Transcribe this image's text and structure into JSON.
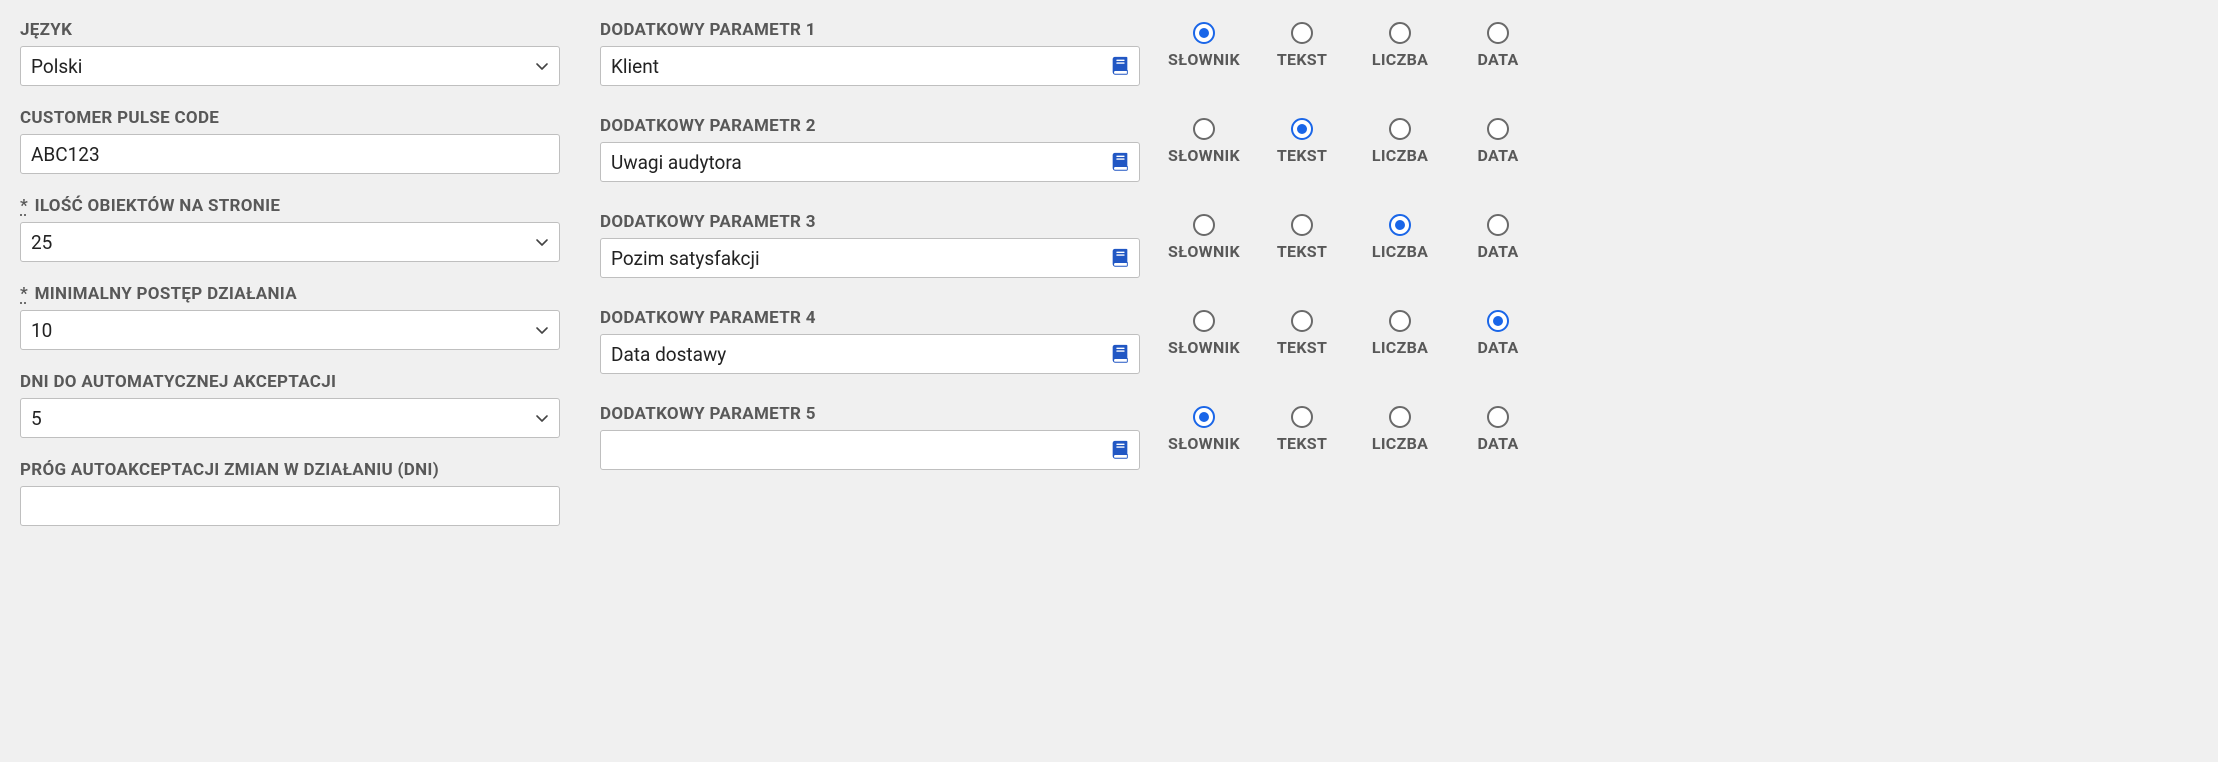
{
  "left": {
    "fields": [
      {
        "label": "JĘZYK",
        "type": "select",
        "value": "Polski",
        "required": false
      },
      {
        "label": "CUSTOMER PULSE CODE",
        "type": "text",
        "value": "ABC123",
        "required": false
      },
      {
        "label": "ILOŚĆ OBIEKTÓW NA STRONIE",
        "type": "select",
        "value": "25",
        "required": true
      },
      {
        "label": "MINIMALNY POSTĘP DZIAŁANIA",
        "type": "select",
        "value": "10",
        "required": true
      },
      {
        "label": "DNI DO AUTOMATYCZNEJ AKCEPTACJI",
        "type": "select",
        "value": "5",
        "required": false
      },
      {
        "label": "PRÓG AUTOAKCEPTACJI ZMIAN W DZIAŁANIU (DNI)",
        "type": "text",
        "value": "",
        "required": false
      }
    ]
  },
  "right": {
    "radio_labels": [
      "SŁOWNIK",
      "TEKST",
      "LICZBA",
      "DATA"
    ],
    "params": [
      {
        "label": "DODATKOWY PARAMETR 1",
        "value": "Klient",
        "selected": 0
      },
      {
        "label": "DODATKOWY PARAMETR 2",
        "value": "Uwagi audytora",
        "selected": 1
      },
      {
        "label": "DODATKOWY PARAMETR 3",
        "value": "Pozim satysfakcji",
        "selected": 2
      },
      {
        "label": "DODATKOWY PARAMETR 4",
        "value": "Data dostawy",
        "selected": 3
      },
      {
        "label": "DODATKOWY PARAMETR 5",
        "value": "",
        "selected": 0
      }
    ]
  }
}
